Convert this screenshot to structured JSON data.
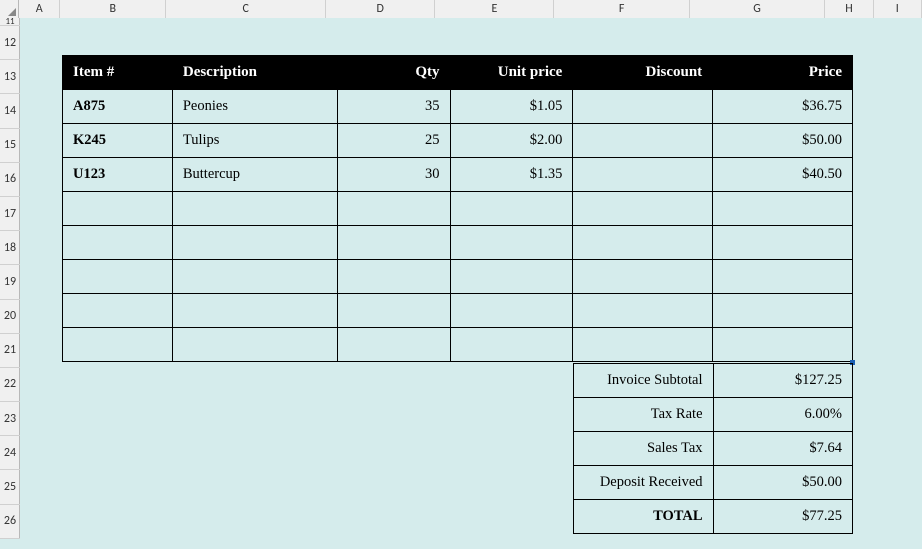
{
  "columns": [
    "A",
    "B",
    "C",
    "D",
    "E",
    "F",
    "G",
    "H",
    "I"
  ],
  "rows": [
    "11",
    "12",
    "13",
    "14",
    "15",
    "16",
    "17",
    "18",
    "19",
    "20",
    "21",
    "22",
    "23",
    "24",
    "25",
    "26"
  ],
  "table": {
    "headers": {
      "item": "Item #",
      "description": "Description",
      "qty": "Qty",
      "unit_price": "Unit price",
      "discount": "Discount",
      "price": "Price"
    },
    "rows": [
      {
        "item": "A875",
        "description": "Peonies",
        "qty": "35",
        "unit_price": "$1.05",
        "discount": "",
        "price": "$36.75"
      },
      {
        "item": "K245",
        "description": "Tulips",
        "qty": "25",
        "unit_price": "$2.00",
        "discount": "",
        "price": "$50.00"
      },
      {
        "item": "U123",
        "description": "Buttercup",
        "qty": "30",
        "unit_price": "$1.35",
        "discount": "",
        "price": "$40.50"
      },
      {
        "item": "",
        "description": "",
        "qty": "",
        "unit_price": "",
        "discount": "",
        "price": ""
      },
      {
        "item": "",
        "description": "",
        "qty": "",
        "unit_price": "",
        "discount": "",
        "price": ""
      },
      {
        "item": "",
        "description": "",
        "qty": "",
        "unit_price": "",
        "discount": "",
        "price": ""
      },
      {
        "item": "",
        "description": "",
        "qty": "",
        "unit_price": "",
        "discount": "",
        "price": ""
      },
      {
        "item": "",
        "description": "",
        "qty": "",
        "unit_price": "",
        "discount": "",
        "price": ""
      }
    ]
  },
  "summary": [
    {
      "label": "Invoice Subtotal",
      "value": "$127.25",
      "bold": false
    },
    {
      "label": "Tax Rate",
      "value": "6.00%",
      "bold": false
    },
    {
      "label": "Sales Tax",
      "value": "$7.64",
      "bold": false
    },
    {
      "label": "Deposit Received",
      "value": "$50.00",
      "bold": false
    },
    {
      "label": "TOTAL",
      "value": "$77.25",
      "bold": true
    }
  ]
}
